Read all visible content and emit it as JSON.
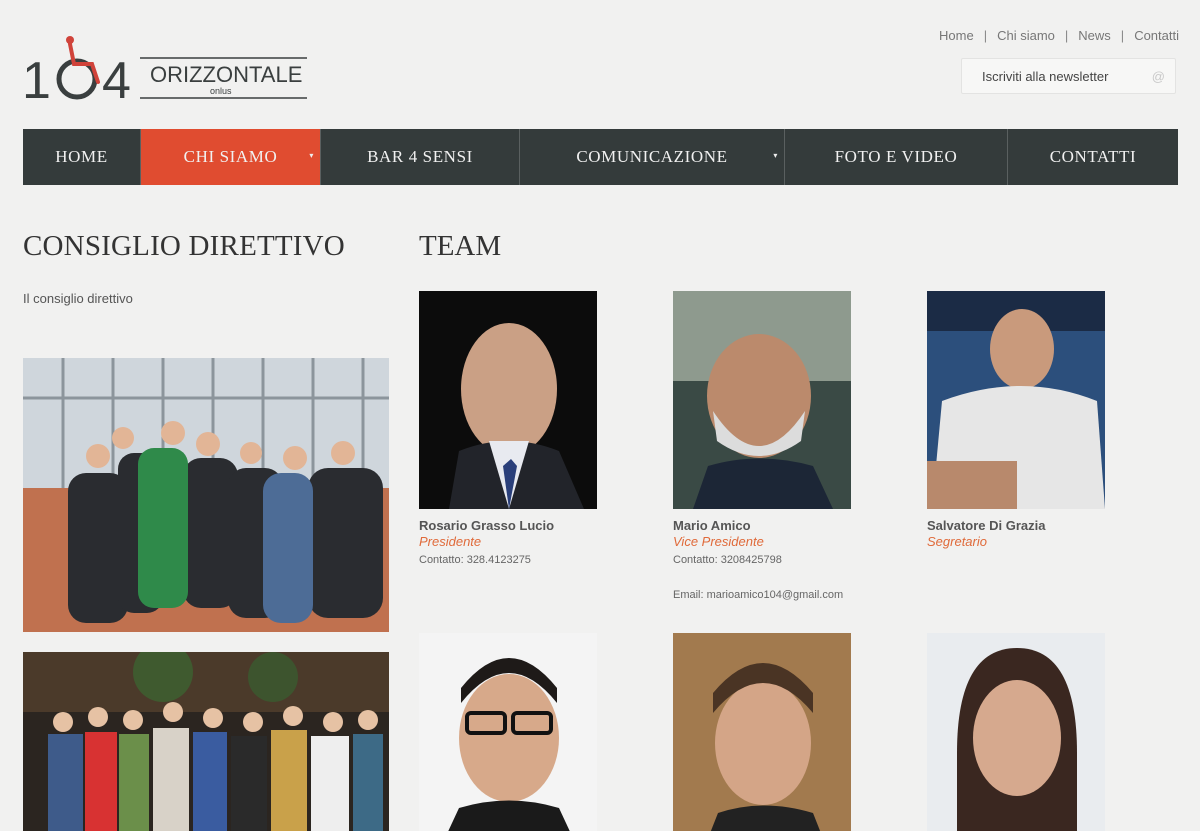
{
  "logo": {
    "number": "104",
    "wordmark": "ORIZZONTALE",
    "sub": "onlus"
  },
  "top_links": [
    "Home",
    "Chi siamo",
    "News",
    "Contatti"
  ],
  "newsletter": {
    "placeholder": "Iscriviti alla newsletter",
    "icon": "@"
  },
  "nav": {
    "items": [
      {
        "label": "HOME",
        "active": false
      },
      {
        "label": "CHI SIAMO",
        "active": true,
        "dropdown": true
      },
      {
        "label": "BAR 4 SENSI",
        "active": false
      },
      {
        "label": "COMUNICAZIONE",
        "active": false,
        "dropdown": true
      },
      {
        "label": "FOTO E VIDEO",
        "active": false
      },
      {
        "label": "CONTATTI",
        "active": false
      }
    ],
    "colors": {
      "bg": "#343b3b",
      "active": "#e04c30"
    }
  },
  "left": {
    "heading": "CONSIGLIO DIRETTIVO",
    "intro": "Il consiglio direttivo"
  },
  "team": {
    "heading": "TEAM",
    "members": [
      {
        "name": "Rosario Grasso Lucio",
        "role": "Presidente",
        "contact": "Contatto: 328.4123275"
      },
      {
        "name": "Mario Amico",
        "role": "Vice Presidente",
        "contact": "Contatto: 3208425798",
        "email": "Email: marioamico104@gmail.com"
      },
      {
        "name": "Salvatore Di Grazia",
        "role": "Segretario"
      }
    ]
  },
  "accent_color": "#e06a3a"
}
